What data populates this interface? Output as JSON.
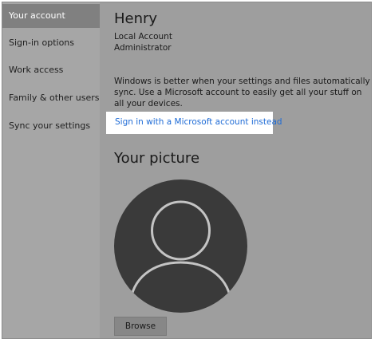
{
  "sidebar": {
    "items": [
      {
        "label": "Your account",
        "selected": true
      },
      {
        "label": "Sign-in options",
        "selected": false
      },
      {
        "label": "Work access",
        "selected": false
      },
      {
        "label": "Family & other users",
        "selected": false
      },
      {
        "label": "Sync your settings",
        "selected": false
      }
    ]
  },
  "account": {
    "name": "Henry",
    "type": "Local Account",
    "role": "Administrator"
  },
  "sync_message": "Windows is better when your settings and files automatically sync. Use a Microsoft account to easily get all your stuff on all your devices.",
  "signin_link": "Sign in with a Microsoft account instead",
  "picture": {
    "heading": "Your picture",
    "avatar_icon": "person-silhouette-icon",
    "browse_label": "Browse"
  },
  "colors": {
    "sidebar_bg": "#a6a6a6",
    "selected_bg": "#808080",
    "main_bg": "#9e9e9e",
    "link": "#1e6bd6",
    "avatar_fill": "#3a3a3a"
  }
}
